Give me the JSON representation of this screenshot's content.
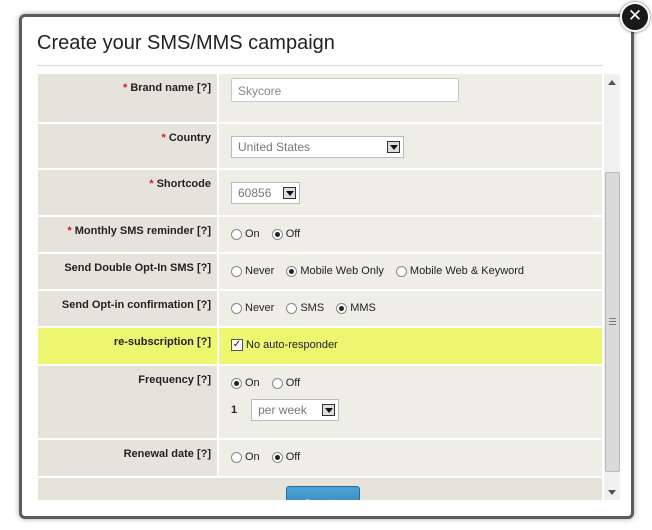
{
  "dialog": {
    "title": "Create your SMS/MMS campaign",
    "close_symbol": "✕"
  },
  "form": {
    "required_mark": "*",
    "brand": {
      "label": "Brand name [?]",
      "value": "Skycore"
    },
    "country": {
      "label": "Country",
      "value": "United States"
    },
    "shortcode": {
      "label": "Shortcode",
      "value": "60856"
    },
    "monthly_reminder": {
      "label": "Monthly SMS reminder [?]",
      "opt_on": "On",
      "opt_off": "Off",
      "selected": "Off"
    },
    "double_optin": {
      "label": "Send Double Opt-In SMS [?]",
      "opt_never": "Never",
      "opt_mobile_web": "Mobile Web Only",
      "opt_mobile_web_keyword": "Mobile Web & Keyword",
      "selected": "Mobile Web Only"
    },
    "optin_confirmation": {
      "label": "Send Opt-in confirmation [?]",
      "opt_never": "Never",
      "opt_sms": "SMS",
      "opt_mms": "MMS",
      "selected": "MMS"
    },
    "resubscription": {
      "label": "re-subscription [?]",
      "checkbox_label": "No auto-responder",
      "checked": true,
      "check_symbol": "✓"
    },
    "frequency": {
      "label": "Frequency [?]",
      "opt_on": "On",
      "opt_off": "Off",
      "selected": "On",
      "count": "1",
      "period": "per week"
    },
    "renewal_date": {
      "label": "Renewal date [?]",
      "opt_on": "On",
      "opt_off": "Off",
      "selected": "Off"
    }
  },
  "actions": {
    "create_label": "Create"
  },
  "colors": {
    "label_bg": "#e6e4da",
    "value_bg": "#eeede6",
    "highlight_bg": "#eef56f",
    "required": "#cc2222",
    "button": "#3a8fc6"
  },
  "icons": {
    "close": "close-icon",
    "dropdown": "chevron-down-icon",
    "scroll_up": "scroll-up-icon",
    "scroll_down": "scroll-down-icon"
  }
}
